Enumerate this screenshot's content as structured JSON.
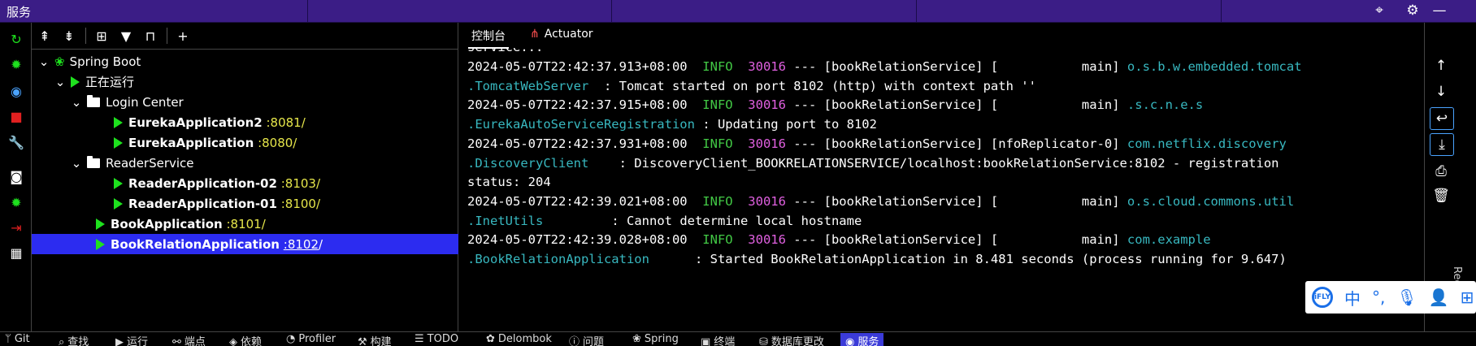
{
  "window": {
    "title": "服务"
  },
  "tree": {
    "root": "Spring Boot",
    "running": "正在运行",
    "groups": [
      {
        "name": "Login Center",
        "apps": [
          {
            "name": "EurekaApplication2",
            "port": ":8081/"
          },
          {
            "name": "EurekaApplication",
            "port": ":8080/"
          }
        ]
      },
      {
        "name": "ReaderService",
        "apps": [
          {
            "name": "ReaderApplication-02",
            "port": ":8103/"
          },
          {
            "name": "ReaderApplication-01",
            "port": ":8100/"
          }
        ]
      }
    ],
    "standalone": [
      {
        "name": "BookApplication",
        "port": ":8101/"
      },
      {
        "name": "BookRelationApplication",
        "port": ":8102",
        "port_suffix": "/"
      }
    ]
  },
  "console": {
    "tabs": [
      "控制台",
      "Actuator"
    ],
    "partial_first_line": "service...",
    "lines": [
      {
        "ts": "2024-05-07T22:42:37.913+08:00",
        "level": "INFO",
        "pid": "30016",
        "mid": " --- [bookRelationService] [           main] ",
        "logger": "o.s.b.w.embedded.tomcat",
        "cont_logger": ".TomcatWebServer",
        "cont_pad": "  ",
        "msg": ": Tomcat started on port 8102 (http) with context path ''"
      },
      {
        "ts": "2024-05-07T22:42:37.915+08:00",
        "level": "INFO",
        "pid": "30016",
        "mid": " --- [bookRelationService] [           main] ",
        "logger": ".s.c.n.e.s",
        "cont_logger": ".EurekaAutoServiceRegistration",
        "cont_pad": " ",
        "msg": ": Updating port to 8102"
      },
      {
        "ts": "2024-05-07T22:42:37.931+08:00",
        "level": "INFO",
        "pid": "30016",
        "mid": " --- [bookRelationService] [nfoReplicator-0] ",
        "logger": "com.netflix.discovery",
        "cont_logger": ".DiscoveryClient",
        "cont_pad": "    ",
        "msg": ": DiscoveryClient_BOOKRELATIONSERVICE/localhost:bookRelationService:8102 - registration",
        "wrap": "status: 204"
      },
      {
        "ts": "2024-05-07T22:42:39.021+08:00",
        "level": "INFO",
        "pid": "30016",
        "mid": " --- [bookRelationService] [           main] ",
        "logger": "o.s.cloud.commons.util",
        "cont_logger": ".InetUtils",
        "cont_pad": "         ",
        "msg": ": Cannot determine local hostname"
      },
      {
        "ts": "2024-05-07T22:42:39.028+08:00",
        "level": "INFO",
        "pid": "30016",
        "mid": " --- [bookRelationService] [           main] ",
        "logger": "com.example",
        "cont_logger": ".BookRelationApplication",
        "cont_pad": "      ",
        "msg": ": Started BookRelationApplication in 8.481 seconds (process running for 9.647)"
      }
    ]
  },
  "right_strip": {
    "vertical_label": "Reque"
  },
  "ime": {
    "logo": "iFLY",
    "mode": "中"
  },
  "statusbar": [
    {
      "label": "Git",
      "icon": "git-branch-icon"
    },
    {
      "label": "查找",
      "icon": "search-icon"
    },
    {
      "label": "运行",
      "icon": "run-icon"
    },
    {
      "label": "端点",
      "icon": "endpoints-icon"
    },
    {
      "label": "依赖",
      "icon": "dependencies-icon"
    },
    {
      "label": "Profiler",
      "icon": "profiler-icon"
    },
    {
      "label": "构建",
      "icon": "build-icon"
    },
    {
      "label": "TODO",
      "icon": "todo-icon"
    },
    {
      "label": "Delombok",
      "icon": "delombok-icon"
    },
    {
      "label": "问题",
      "icon": "problems-icon"
    },
    {
      "label": "Spring",
      "icon": "spring-icon"
    },
    {
      "label": "终端",
      "icon": "terminal-icon"
    },
    {
      "label": "数据库更改",
      "icon": "database-icon"
    },
    {
      "label": "服务",
      "icon": "services-icon",
      "active": true
    }
  ],
  "colors": {
    "titlebar": "#3b1d86",
    "selection": "#2c2cf0",
    "run_green": "#1ee11e",
    "info_green": "#42c845",
    "pid_magenta": "#e060e0",
    "logger_cyan": "#38b8c0",
    "port_yellow": "#e6e64a"
  }
}
